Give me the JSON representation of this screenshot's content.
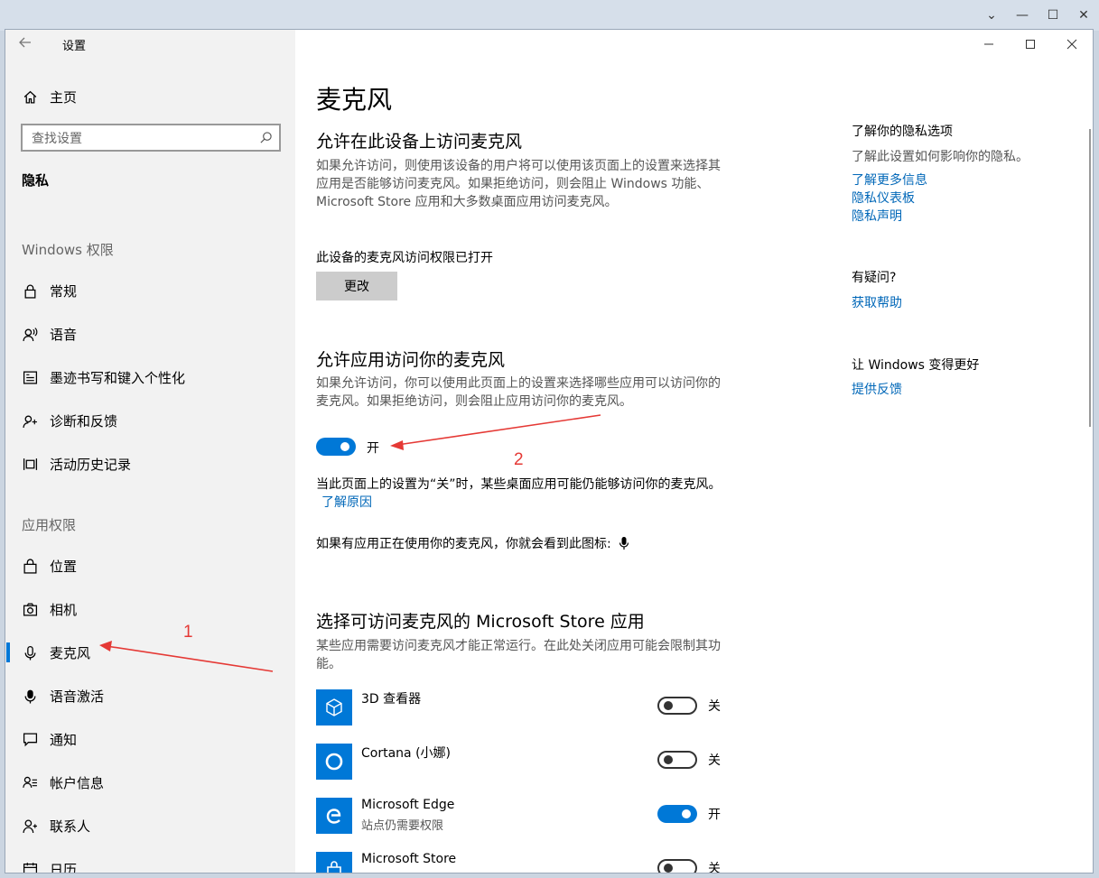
{
  "window": {
    "title": "设置"
  },
  "sidebar": {
    "home_label": "主页",
    "search_placeholder": "查找设置",
    "section_title": "隐私",
    "windows_permissions_label": "Windows 权限",
    "windows_items": [
      {
        "label": "常规",
        "icon": "lock-icon"
      },
      {
        "label": "语音",
        "icon": "speech-icon"
      },
      {
        "label": "墨迹书写和键入个性化",
        "icon": "ink-icon"
      },
      {
        "label": "诊断和反馈",
        "icon": "diagnostics-icon"
      },
      {
        "label": "活动历史记录",
        "icon": "timeline-icon"
      }
    ],
    "app_permissions_label": "应用权限",
    "app_items": [
      {
        "label": "位置",
        "icon": "location-icon"
      },
      {
        "label": "相机",
        "icon": "camera-icon"
      },
      {
        "label": "麦克风",
        "icon": "microphone-icon",
        "active": true
      },
      {
        "label": "语音激活",
        "icon": "voice-activation-icon"
      },
      {
        "label": "通知",
        "icon": "notification-icon"
      },
      {
        "label": "帐户信息",
        "icon": "account-info-icon"
      },
      {
        "label": "联系人",
        "icon": "contacts-icon"
      },
      {
        "label": "日历",
        "icon": "calendar-icon"
      }
    ]
  },
  "main": {
    "page_title": "麦克风",
    "device_section": {
      "heading": "允许在此设备上访问麦克风",
      "description": "如果允许访问，则使用该设备的用户将可以使用该页面上的设置来选择其应用是否能够访问麦克风。如果拒绝访问，则会阻止 Windows 功能、Microsoft Store 应用和大多数桌面应用访问麦克风。",
      "status": "此设备的麦克风访问权限已打开",
      "change_button": "更改"
    },
    "apps_section": {
      "heading": "允许应用访问你的麦克风",
      "description": "如果允许访问，你可以使用此页面上的设置来选择哪些应用可以访问你的麦克风。如果拒绝访问，则会阻止应用访问你的麦克风。",
      "toggle_state": "开",
      "note": "当此页面上的设置为“关”时，某些桌面应用可能仍能够访问你的麦克风。",
      "note_link": "了解原因",
      "indicator_text": "如果有应用正在使用你的麦克风，你就会看到此图标:"
    },
    "store_section": {
      "heading": "选择可访问麦克风的 Microsoft Store 应用",
      "description": "某些应用需要访问麦克风才能正常运行。在此处关闭应用可能会限制其功能。",
      "apps": [
        {
          "name": "3D 查看器",
          "sub": "",
          "state": "关",
          "on": false,
          "icon": "3d-viewer-icon"
        },
        {
          "name": "Cortana (小娜)",
          "sub": "",
          "state": "关",
          "on": false,
          "icon": "cortana-icon"
        },
        {
          "name": "Microsoft Edge",
          "sub": "站点仍需要权限",
          "state": "开",
          "on": true,
          "icon": "edge-icon"
        },
        {
          "name": "Microsoft Store",
          "sub": "",
          "state": "关",
          "on": false,
          "icon": "store-icon"
        }
      ]
    }
  },
  "right_column": {
    "privacy_heading": "了解你的隐私选项",
    "privacy_sub": "了解此设置如何影响你的隐私。",
    "links": [
      "了解更多信息",
      "隐私仪表板",
      "隐私声明"
    ],
    "question_heading": "有疑问?",
    "help_link": "获取帮助",
    "better_heading": "让 Windows 变得更好",
    "feedback_link": "提供反馈"
  },
  "annotations": {
    "label_1": "1",
    "label_2": "2",
    "color": "#e53935"
  },
  "colors": {
    "accent": "#0078d7",
    "sidebar_bg": "#f2f2f2",
    "link": "#0067b8"
  }
}
